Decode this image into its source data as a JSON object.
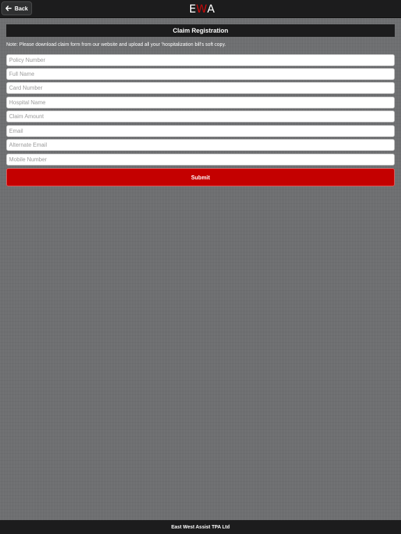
{
  "header": {
    "back_label": "Back",
    "logo": {
      "left": "E",
      "mid": "W",
      "right": "A"
    }
  },
  "form": {
    "title": "Claim Registration",
    "note": "Note: Please download claim form from our website and upload all your 'hospitalization bill's soft copy.",
    "fields": [
      {
        "placeholder": "Policy Number"
      },
      {
        "placeholder": "Full Name"
      },
      {
        "placeholder": "Card Number"
      },
      {
        "placeholder": "Hospital Name"
      },
      {
        "placeholder": "Claim Amount"
      },
      {
        "placeholder": "Email"
      },
      {
        "placeholder": "Alternate Email"
      },
      {
        "placeholder": "Mobile Number"
      }
    ],
    "submit_label": "Submit"
  },
  "footer": {
    "text": "East West Assist TPA Ltd"
  },
  "colors": {
    "bar_bg": "#1c1c1d",
    "accent_red": "#c40000",
    "background": "#6e6f71"
  },
  "icons": {
    "back": "arrow-left-icon"
  }
}
